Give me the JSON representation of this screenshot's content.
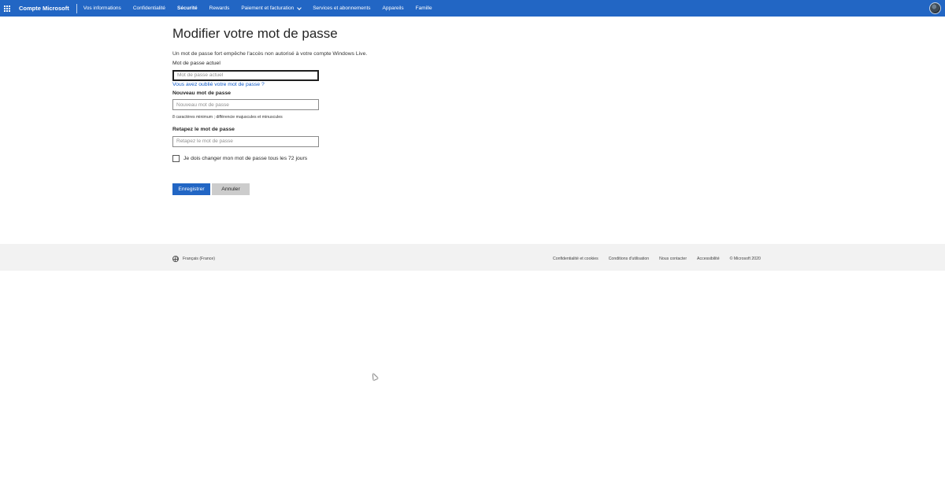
{
  "nav": {
    "brand": "Compte Microsoft",
    "items": [
      {
        "label": "Vos informations"
      },
      {
        "label": "Confidentialité"
      },
      {
        "label": "Sécurité"
      },
      {
        "label": "Rewards"
      },
      {
        "label": "Paiement et facturation"
      },
      {
        "label": "Services et abonnements"
      },
      {
        "label": "Appareils"
      },
      {
        "label": "Famille"
      }
    ],
    "active": "Sécurité",
    "icons": {
      "menu": "waffle-icon",
      "dropdown": "chevron-down-icon",
      "avatar": "user-avatar"
    }
  },
  "form": {
    "title": "Modifier votre mot de passe",
    "intro": "Un mot de passe fort empêche l'accès non autorisé à votre compte Windows Live.",
    "current": {
      "label": "Mot de passe actuel",
      "placeholder": "Mot de passe actuel",
      "value": ""
    },
    "forgot_link": "Vous avez oublié votre mot de passe ?",
    "new": {
      "label": "Nouveau mot de passe",
      "placeholder": "Nouveau mot de passe",
      "value": "",
      "hint": "8 caractères minimum ; différencie majuscules et minuscules"
    },
    "confirm": {
      "label": "Retapez le mot de passe",
      "placeholder": "Retapez le mot de passe",
      "value": ""
    },
    "rotate_checkbox": {
      "label": "Je dois changer mon mot de passe tous les 72 jours",
      "checked": false
    },
    "save_label": "Enregistrer",
    "cancel_label": "Annuler"
  },
  "footer": {
    "locale": "Français (France)",
    "links": [
      "Confidentialité et cookies",
      "Conditions d'utilisation",
      "Nous contacter",
      "Accessibilité"
    ],
    "copyright": "© Microsoft 2020"
  },
  "colors": {
    "accent": "#2266c4",
    "link": "#0f5ac8",
    "footer_bg": "#f2f2f2",
    "secondary_button": "#cccccc"
  }
}
